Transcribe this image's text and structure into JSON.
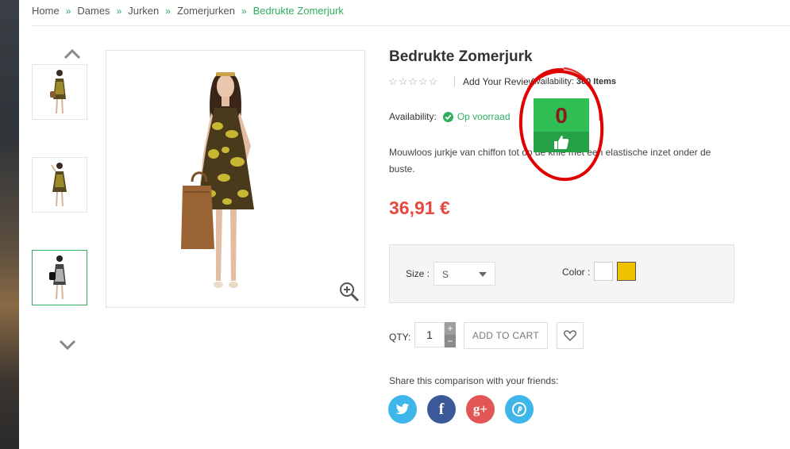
{
  "breadcrumb": {
    "items": [
      "Home",
      "Dames",
      "Jurken",
      "Zomerjurken"
    ],
    "current": "Bedrukte Zomerjurk",
    "separator": "»"
  },
  "product": {
    "title": "Bedrukte Zomerjurk",
    "stars": "☆☆☆☆☆",
    "add_review": "Add Your Review",
    "availability_label": "Availability:",
    "availability_count": "300 Items",
    "stock_label": "Availability:",
    "stock_value": "Op voorraad",
    "description": "Mouwloos jurkje van chiffon tot op de knie met een elastische inzet onder de buste.",
    "price": "36,91 €"
  },
  "like_widget": {
    "count": "0"
  },
  "options": {
    "size_label": "Size :",
    "size_value": "S",
    "color_label": "Color :",
    "colors": [
      "#ffffff",
      "#f0c300"
    ]
  },
  "cart": {
    "qty_label": "QTY:",
    "qty_value": "1",
    "plus": "+",
    "minus": "−",
    "add_to_cart": "ADD TO CART"
  },
  "share": {
    "label": "Share this comparison with your friends:",
    "networks": [
      "twitter",
      "facebook",
      "google-plus",
      "pinterest"
    ],
    "fb_glyph": "f",
    "gp_glyph": "g+"
  },
  "colors": {
    "accent": "#2fae5f",
    "price": "#e8493f",
    "like_green": "#2fbf55",
    "annotation_red": "#e00000"
  }
}
